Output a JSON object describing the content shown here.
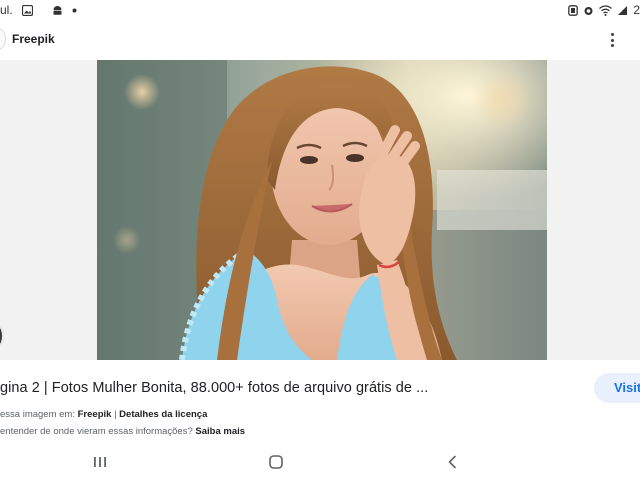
{
  "status_bar": {
    "carrier_fragment": "ul.",
    "time_fragment": "2"
  },
  "app": {
    "title": "Freepik"
  },
  "result": {
    "title": "gina 2 | Fotos Mulher Bonita, 88.000+ fotos de arquivo grátis de ...",
    "visit_label": "Visita",
    "source_prefix": "essa imagem em:",
    "source_name": "Freepik",
    "separator": "|",
    "license_label": "Detalhes da licença",
    "info_text": "entender de onde vieram essas informações?",
    "learn_more": "Saiba mais"
  },
  "icons": {
    "status": [
      "gallery-icon",
      "android-icon",
      "dot-icon",
      "nfc-icon",
      "alarm-icon",
      "wifi-icon",
      "signal-icon"
    ],
    "nav": [
      "recents-icon",
      "home-icon",
      "back-icon"
    ],
    "menu": "more-vert-icon"
  },
  "colors": {
    "accent": "#1a73e8",
    "visit_bg": "#e8f0fe",
    "background": "#ffffff",
    "stage_bg": "#f2f2f2"
  }
}
